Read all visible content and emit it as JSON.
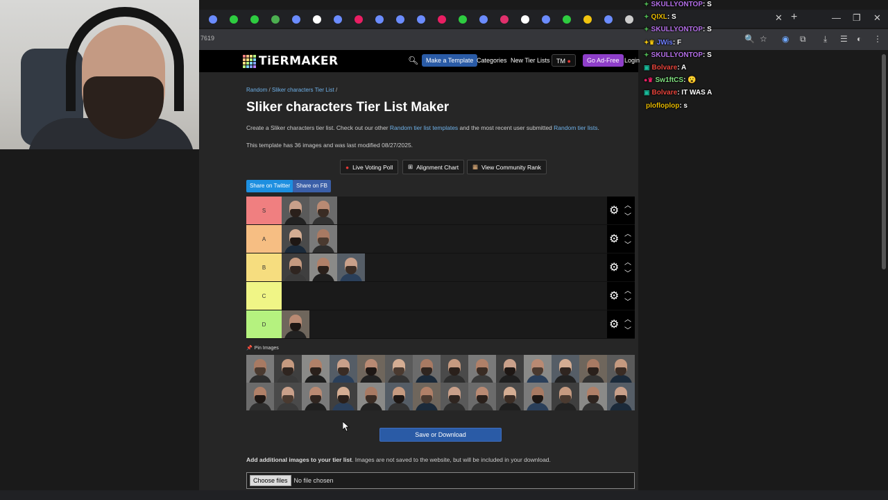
{
  "browser": {
    "url_fragment": "7619",
    "close_tab": "✕",
    "new_tab": "+",
    "minimize": "—",
    "restore": "❐",
    "close_window": "✕",
    "tab_icon_colors": [
      "#6b8cff",
      "#2ecc40",
      "#2ecc40",
      "#4caf50",
      "#6b8cff",
      "#ffffff",
      "#6b8cff",
      "#e91e63",
      "#6b8cff",
      "#6b8cff",
      "#6b8cff",
      "#e91e63",
      "#2ecc40",
      "#6b8cff",
      "#e1306c",
      "#ffffff",
      "#6b8cff",
      "#2ecc40",
      "#f1c40f",
      "#6b8cff",
      "#cccccc"
    ]
  },
  "site": {
    "logo": "TiERMAKER",
    "nav": {
      "make_template": "Make a Template",
      "categories": "Categories",
      "new_tier_lists": "New Tier Lists",
      "tm": "TM",
      "go_ad_free": "Go Ad-Free",
      "login": "Login"
    }
  },
  "page": {
    "breadcrumb": {
      "random": "Random",
      "sep1": " / ",
      "list": "Sliker characters Tier List",
      "sep2": " /"
    },
    "title": "Sliker characters Tier List Maker",
    "intro_1": "Create a Sliker characters tier list. Check out our other ",
    "intro_link_1": "Random tier list templates",
    "intro_2": " and the most recent user submitted ",
    "intro_link_2": "Random tier lists",
    "intro_3": ".",
    "info": "This template has 36 images and was last modified 08/27/2025.",
    "buttons": {
      "live_voting": "Live Voting Poll",
      "alignment": "Alignment Chart",
      "community": "View Community Rank"
    },
    "share_twitter": "Share on Twitter",
    "share_fb": "Share on FB",
    "pin_images": "Pin Images",
    "save": "Save or Download",
    "add_images_bold": "Add additional images to your tier list",
    "add_images_rest": ". Images are not saved to the website, but will be included in your download.",
    "choose_files": "Choose files",
    "no_file": "No file chosen"
  },
  "tiers": [
    {
      "label": "S",
      "color": "#f07f80",
      "count": 2
    },
    {
      "label": "A",
      "color": "#f6be83",
      "count": 2
    },
    {
      "label": "B",
      "color": "#f6dd7f",
      "count": 3
    },
    {
      "label": "C",
      "color": "#f0f586",
      "count": 0
    },
    {
      "label": "D",
      "color": "#b5f27f",
      "count": 1
    }
  ],
  "pool_count": 28,
  "chat": [
    {
      "user": "SKULLYONTOP",
      "color": "#b46fe8",
      "badge": "✦",
      "badge_color": "#4caf50",
      "msg": ": S"
    },
    {
      "user": "QIXL",
      "color": "#e6b800",
      "badge": "✦",
      "badge_color": "#4caf50",
      "msg": ": S"
    },
    {
      "user": "SKULLYONTOP",
      "color": "#b46fe8",
      "badge": "✦",
      "badge_color": "#4caf50",
      "msg": ": S"
    },
    {
      "user": "JWis",
      "color": "#6f7fff",
      "badge": "✦♛",
      "badge_color": "#f1c40f",
      "msg": ": F"
    },
    {
      "user": "SKULLYONTOP",
      "color": "#b46fe8",
      "badge": "✦",
      "badge_color": "#4caf50",
      "msg": ": S"
    },
    {
      "user": "Bolvare",
      "color": "#e8453c",
      "badge": "▣",
      "badge_color": "#1abc9c",
      "msg": ": A"
    },
    {
      "user": "Sw1ftCS",
      "color": "#7fe07f",
      "badge": "●♛",
      "badge_color": "#e91e63",
      "msg": ": 😮"
    },
    {
      "user": "Bolvare",
      "color": "#e8453c",
      "badge": "▣",
      "badge_color": "#1abc9c",
      "msg": ": IT WAS A"
    },
    {
      "user": "plofloplop",
      "color": "#e6b800",
      "badge": "",
      "badge_color": "#ffffff",
      "msg": ": s"
    }
  ]
}
